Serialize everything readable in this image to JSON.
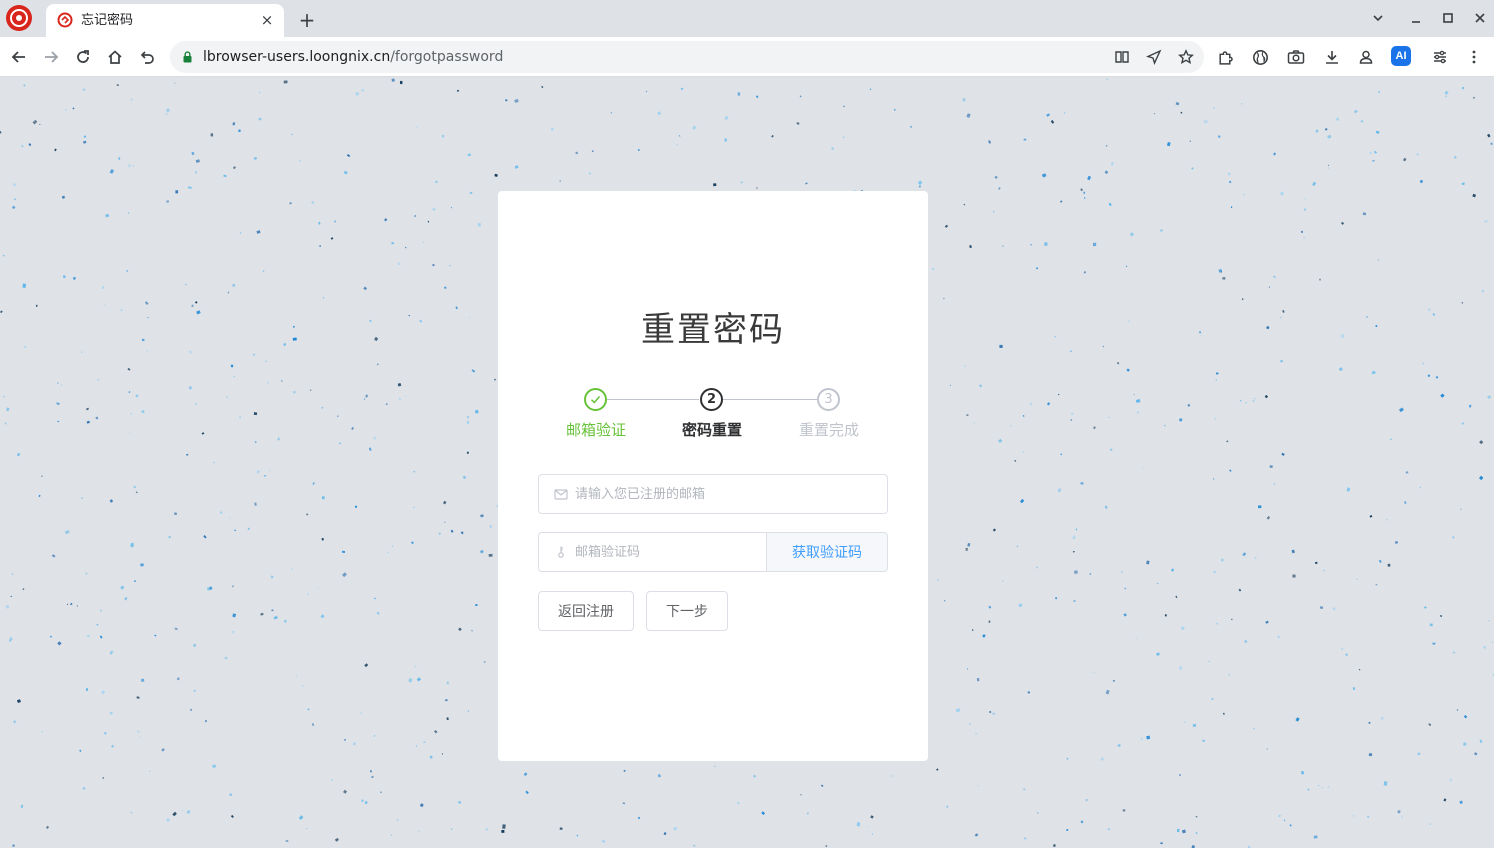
{
  "browser": {
    "tab_title": "忘记密码",
    "new_tab_symbol": "+",
    "close_symbol": "×",
    "url_host": "lbrowser-users.loongnix.cn",
    "url_path": "/forgotpassword",
    "ai_label": "AI",
    "accent_color": "#1a73e8",
    "logo_color": "#d8261c"
  },
  "page": {
    "title": "重置密码",
    "steps": [
      {
        "index": "1",
        "label": "邮箱验证",
        "state": "done",
        "color": "#67c23a"
      },
      {
        "index": "2",
        "label": "密码重置",
        "state": "active",
        "color": "#303133"
      },
      {
        "index": "3",
        "label": "重置完成",
        "state": "pending",
        "color": "#c0c4cc"
      }
    ],
    "email_placeholder": "请输入您已注册的邮箱",
    "code_placeholder": "邮箱验证码",
    "get_code_label": "获取验证码",
    "back_label": "返回注册",
    "next_label": "下一步",
    "link_color": "#409eff"
  }
}
